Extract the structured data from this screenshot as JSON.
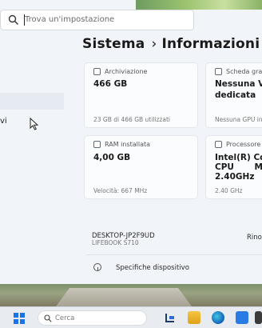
{
  "search": {
    "placeholder": "Trova un'impostazione"
  },
  "sidebar": {
    "partial_item_label": "vi"
  },
  "header": {
    "section": "Sistema",
    "separator": "›",
    "page": "Informazioni s"
  },
  "cards": {
    "storage": {
      "label": "Archiviazione",
      "value": "466 GB",
      "detail": "23 GB di 466 GB utilizzati"
    },
    "graphics": {
      "label": "Scheda grafi",
      "value_line1": "Nessuna VR",
      "value_line2": "dedicata",
      "detail": "Nessuna GPU in"
    },
    "ram": {
      "label": "RAM installata",
      "value": "4,00 GB",
      "detail": "Velocità: 667 MHz"
    },
    "processor": {
      "label": "Processore",
      "value_line1": "Intel(R) Core",
      "value_line2": "CPU       M 3",
      "value_line3": "2.40GHz",
      "detail": "2.40 GHz"
    }
  },
  "device": {
    "name": "DESKTOP-JP2F9UD",
    "model": "LIFEBOOK S710",
    "rename_label": "Rino"
  },
  "specs": {
    "label": "Specifiche dispositivo"
  },
  "taskbar": {
    "search_label": "Cerca"
  },
  "colors": {
    "accent": "#1a74e8",
    "window_bg": "#f1f4f8",
    "card_bg": "#fbfcfd"
  }
}
